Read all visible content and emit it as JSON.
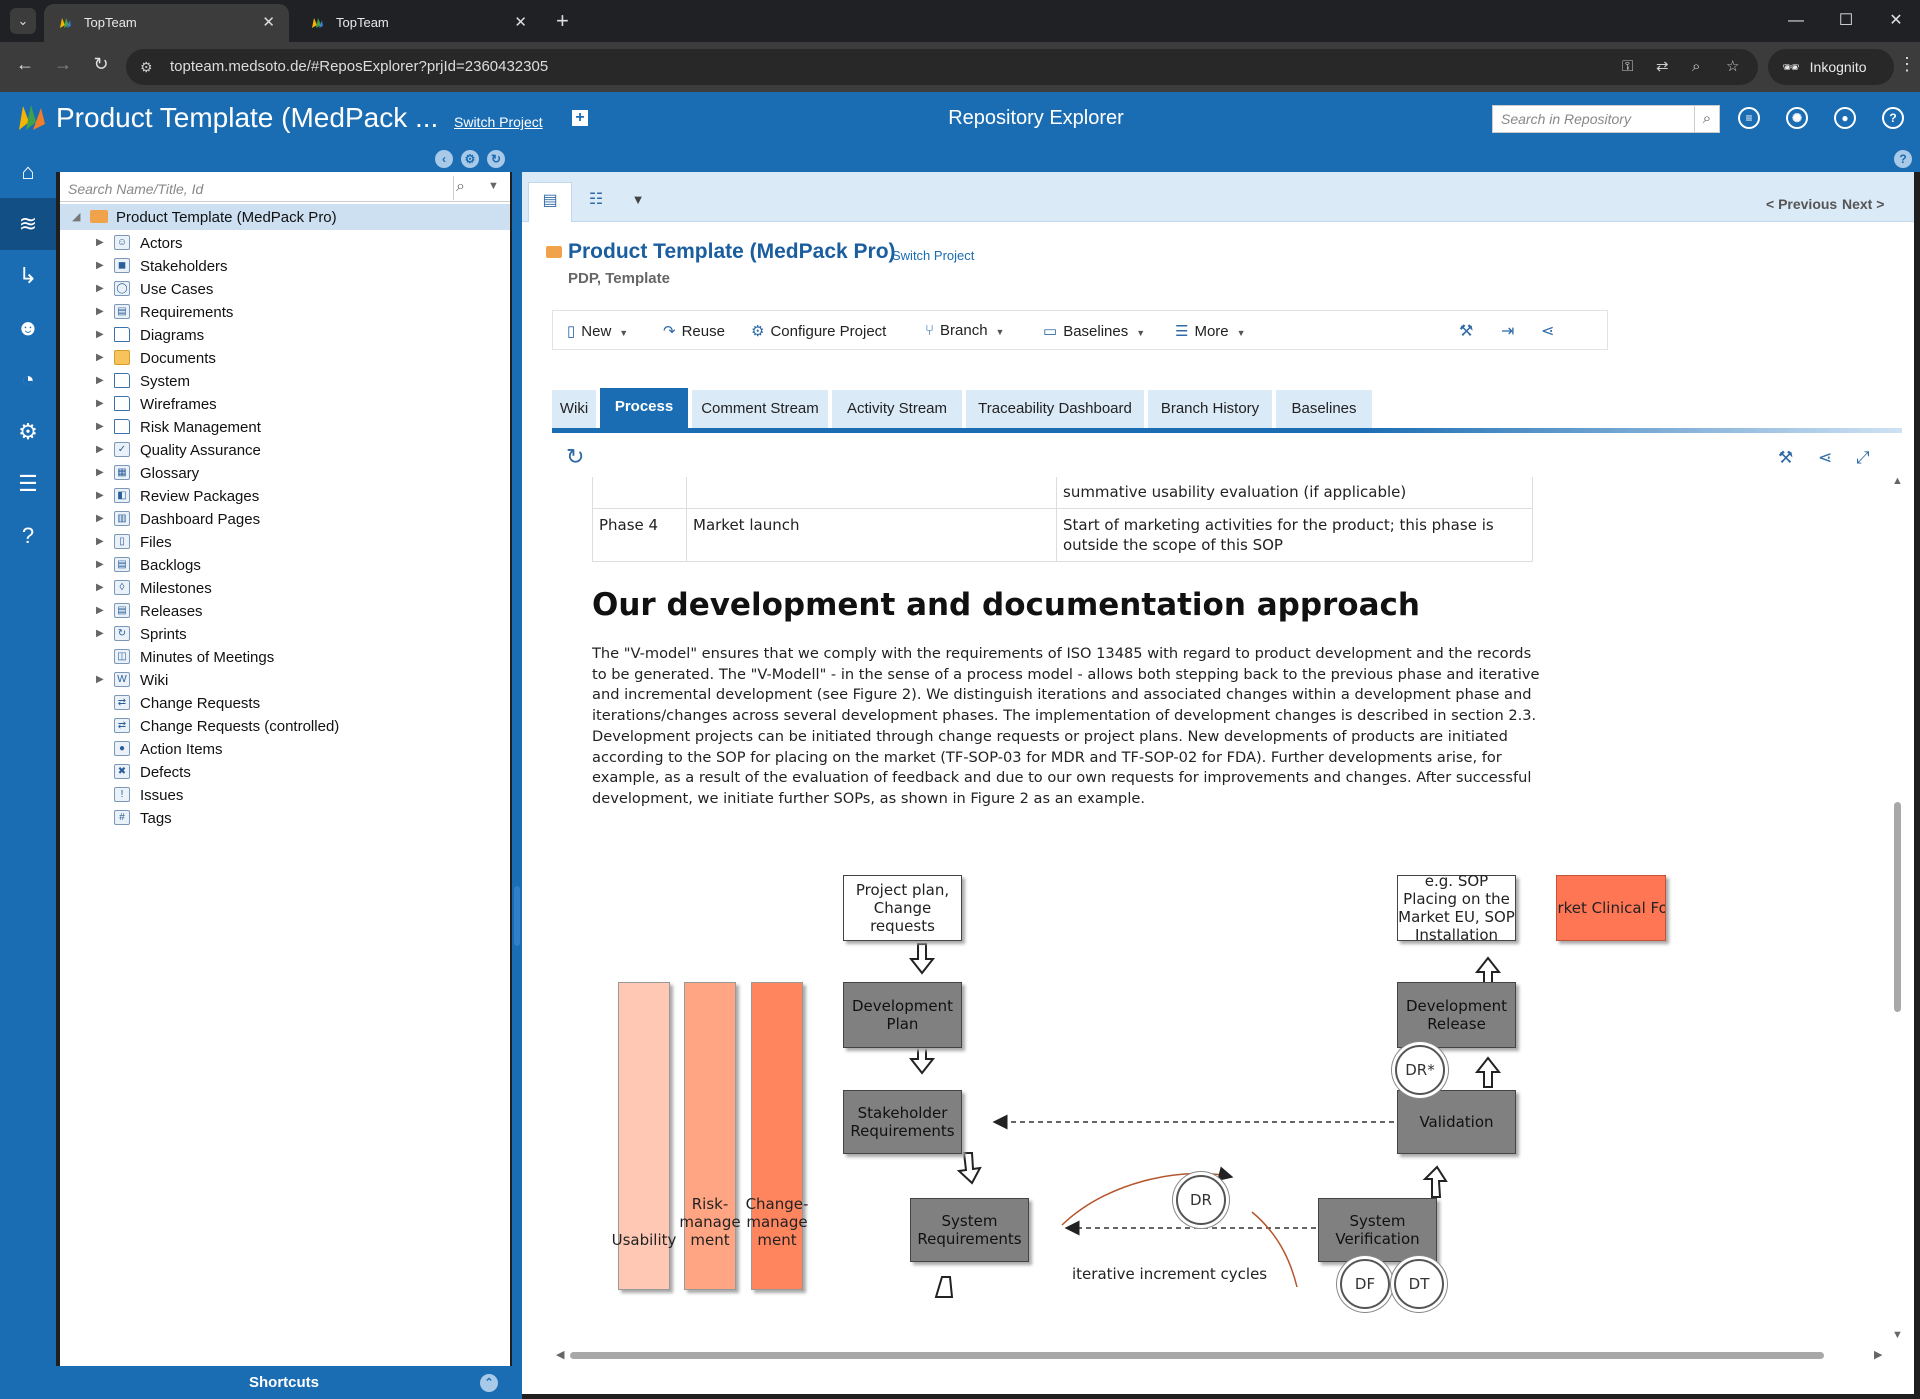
{
  "browser": {
    "tabs": [
      {
        "title": "TopTeam"
      },
      {
        "title": "TopTeam"
      }
    ],
    "url": "topteam.medsoto.de/#ReposExplorer?prjId=2360432305",
    "incognito_label": "Inkognito"
  },
  "header": {
    "project_title": "Product Template (MedPack ...",
    "switch_project": "Switch Project",
    "center_title": "Repository Explorer",
    "search_placeholder": "Search in Repository"
  },
  "tree": {
    "search_placeholder": "Search Name/Title, Id",
    "root": "Product Template (MedPack Pro)",
    "items": [
      {
        "label": "Actors",
        "icon": "actor-icon"
      },
      {
        "label": "Stakeholders",
        "icon": "stakeholder-icon"
      },
      {
        "label": "Use Cases",
        "icon": "use-case-icon"
      },
      {
        "label": "Requirements",
        "icon": "requirement-icon"
      },
      {
        "label": "Diagrams",
        "icon": "folder-icon"
      },
      {
        "label": "Documents",
        "icon": "yellow-folder-icon"
      },
      {
        "label": "System",
        "icon": "folder-icon"
      },
      {
        "label": "Wireframes",
        "icon": "folder-icon"
      },
      {
        "label": "Risk Management",
        "icon": "folder-icon"
      },
      {
        "label": "Quality Assurance",
        "icon": "check-circle-icon"
      },
      {
        "label": "Glossary",
        "icon": "glossary-icon"
      },
      {
        "label": "Review Packages",
        "icon": "review-package-icon"
      },
      {
        "label": "Dashboard Pages",
        "icon": "dashboard-icon"
      },
      {
        "label": "Files",
        "icon": "file-icon"
      },
      {
        "label": "Backlogs",
        "icon": "backlog-icon"
      },
      {
        "label": "Milestones",
        "icon": "milestone-icon"
      },
      {
        "label": "Releases",
        "icon": "release-icon"
      },
      {
        "label": "Sprints",
        "icon": "sprint-icon"
      },
      {
        "label": "Minutes of Meetings",
        "icon": "minutes-icon"
      },
      {
        "label": "Wiki",
        "icon": "wiki-icon"
      },
      {
        "label": "Change Requests",
        "icon": "change-request-icon"
      },
      {
        "label": "Change Requests (controlled)",
        "icon": "change-request-icon"
      },
      {
        "label": "Action Items",
        "icon": "action-item-icon"
      },
      {
        "label": "Defects",
        "icon": "defect-icon"
      },
      {
        "label": "Issues",
        "icon": "issue-icon"
      },
      {
        "label": "Tags",
        "icon": "tag-icon"
      }
    ],
    "shortcuts": "Shortcuts"
  },
  "main": {
    "prev": "< Previous",
    "next": "Next >",
    "title": "Product Template (MedPack Pro)",
    "switch_project": "Switch Project",
    "subtitle": "PDP, Template",
    "toolbar": {
      "new": "New",
      "reuse": "Reuse",
      "configure": "Configure Project",
      "branch": "Branch",
      "baselines": "Baselines",
      "more": "More"
    },
    "tabs": [
      "Wiki",
      "Process",
      "Comment Stream",
      "Activity Stream",
      "Traceability Dashboard",
      "Branch History",
      "Baselines"
    ],
    "active_tab": "Process"
  },
  "doc": {
    "table": [
      {
        "phase": "",
        "name": "",
        "desc": "summative usability evaluation (if applicable)"
      },
      {
        "phase": "Phase 4",
        "name": "Market launch",
        "desc": "Start of marketing activities for the product; this phase is outside the scope of this SOP"
      }
    ],
    "heading": "Our development and documentation approach",
    "paragraph": "The \"V-model\" ensures that we comply with the requirements of ISO 13485 with regard to product development and the records to be generated. The \"V-Modell\" - in the sense of a process model - allows both stepping back to the previous phase and iterative and incremental development (see Figure 2). We distinguish iterations and associated changes within a development phase and iterations/changes across several development phases. The implementation of development changes is described in section 2.3. Development projects can be initiated through change requests or project plans. New developments of products are initiated according to the SOP for placing on the market (TF-SOP-03 for MDR and TF-SOP-02 for FDA). Further developments arise, for example, as a result of the evaluation of feedback and due to our own requests for improvements and changes. After successful development, we initiate further SOPs, as shown in Figure 2 as an example.",
    "diagram": {
      "project_plan": "Project plan, Change requests",
      "development_plan": "Development Plan",
      "stakeholder_requirements": "Stakeholder Requirements",
      "system_requirements": "System Requirements",
      "sop_placing": "e.g. SOP Placing on the Market EU, SOP Installation",
      "post_market": "Post Market Clinical Follow Up",
      "development_release": "Development Release",
      "validation": "Validation",
      "system_verification": "System Verification",
      "usability": "Usability",
      "risk": "Risk-manage ment",
      "change": "Change-manage ment",
      "dr_star": "DR*",
      "dr": "DR",
      "df": "DF",
      "dt": "DT",
      "iterative": "iterative increment cycles"
    }
  }
}
